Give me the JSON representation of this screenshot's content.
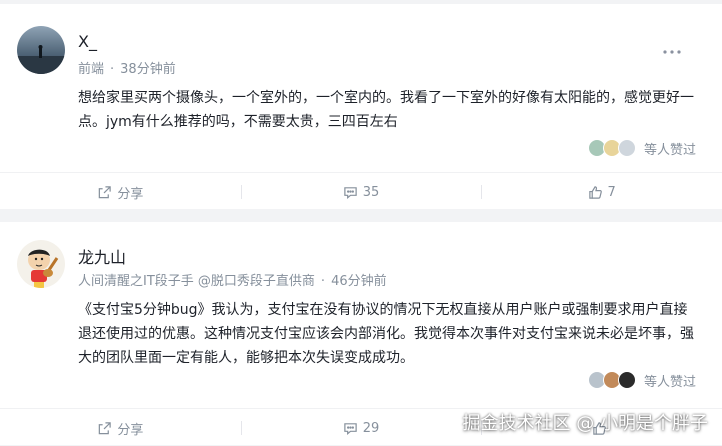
{
  "posts": [
    {
      "author": "X_",
      "meta_parts": [
        "前端",
        "38分钟前"
      ],
      "content": "想给家里买两个摄像头，一个室外的，一个室内的。我看了一下室外的好像有太阳能的，感觉更好一点。jym有什么推荐的吗，不需要太贵，三四百左右",
      "likers_text": "等人赞过",
      "actions": {
        "share": "分享",
        "comments": "35",
        "likes": "7"
      }
    },
    {
      "author": "龙九山",
      "meta_parts": [
        "人间清醒之IT段子手 @脱口秀段子直供商",
        "46分钟前"
      ],
      "content": "《支付宝5分钟bug》我认为，支付宝在没有协议的情况下无权直接从用户账户或强制要求用户直接退还使用过的优惠。这种情况支付宝应该会内部消化。我觉得本次事件对支付宝来说未必是坏事，强大的团队里面一定有能人，能够把本次失误变成成功。",
      "likers_text": "等人赞过",
      "actions": {
        "share": "分享",
        "comments": "29"
      }
    }
  ],
  "watermark": "掘金技术社区 @ 小明是个胖子",
  "colors": {
    "meta": "#86909c",
    "text": "#1d2129",
    "background": "#f2f3f5"
  }
}
